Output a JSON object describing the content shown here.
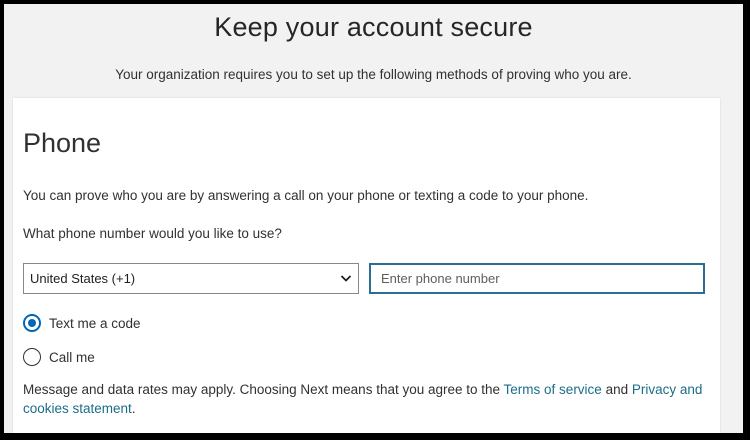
{
  "header": {
    "title": "Keep your account secure",
    "subtitle": "Your organization requires you to set up the following methods of proving who you are."
  },
  "card": {
    "title": "Phone",
    "description": "You can prove who you are by answering a call on your phone or texting a code to your phone.",
    "question": "What phone number would you like to use?",
    "country_select": {
      "selected": "United States (+1)"
    },
    "phone_input": {
      "placeholder": "Enter phone number",
      "value": ""
    },
    "options": [
      {
        "label": "Text me a code",
        "checked": true
      },
      {
        "label": "Call me",
        "checked": false
      }
    ],
    "disclaimer": {
      "text_before": "Message and data rates may apply. Choosing Next means that you agree to the ",
      "terms_link": "Terms of service",
      "text_middle": " and ",
      "privacy_link": "Privacy and cookies statement",
      "text_after": "."
    }
  },
  "colors": {
    "accent": "#0067b8",
    "link": "#1b6d8a",
    "input_focus_border": "#2a6f8f"
  }
}
